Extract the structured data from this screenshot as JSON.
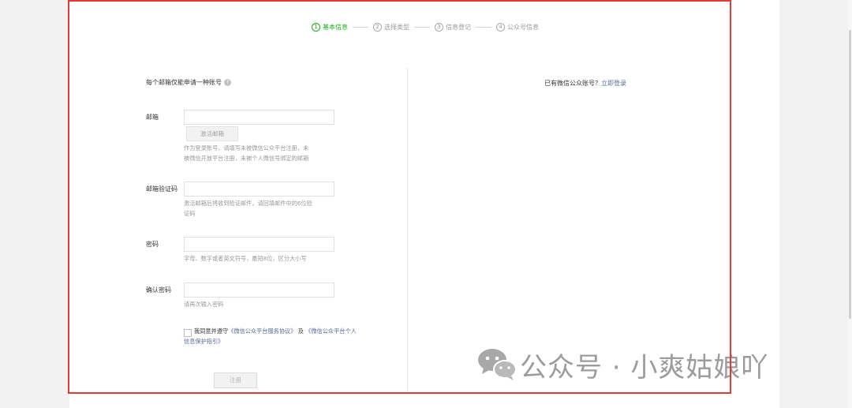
{
  "steps": [
    {
      "num": "1",
      "label": "基本信息",
      "active": true
    },
    {
      "num": "2",
      "label": "选择类型",
      "active": false
    },
    {
      "num": "3",
      "label": "信息登记",
      "active": false
    },
    {
      "num": "4",
      "label": "公众号信息",
      "active": false
    }
  ],
  "form": {
    "tip": "每个邮箱仅能申请一种账号",
    "help_icon_text": "?",
    "email": {
      "label": "邮箱",
      "value": "",
      "activate_label": "激活邮箱",
      "hint_line1": "作为登录账号，请填写未被微信公众平台注册，未",
      "hint_line2": "被微信开放平台注册，未被个人微信号绑定的邮箱"
    },
    "code": {
      "label": "邮箱验证码",
      "value": "",
      "hint_line1": "激活邮箱后将收到验证邮件，请回填邮件中的6位验",
      "hint_line2": "证码"
    },
    "password": {
      "label": "密码",
      "value": "",
      "hint": "字母、数字或者英文符号，最短8位，区分大小写"
    },
    "confirm": {
      "label": "确认密码",
      "value": "",
      "hint": "请再次输入密码"
    },
    "agree": {
      "prefix": "我同意并遵守",
      "link1": "《微信公众平台服务协议》",
      "mid": " 及 ",
      "link2_part1": "《微信公众平台个人",
      "link2_part2": "信息保护指引》"
    },
    "submit_label": "注册"
  },
  "right": {
    "prompt": "已有微信公众账号？",
    "login_link": "立即登录"
  },
  "watermark": {
    "icon": "wechat-icon",
    "text": "公众号 · 小爽姑娘吖"
  },
  "colors": {
    "accent_green": "#1aad19",
    "link_blue": "#576b95",
    "highlight_red": "#e53935"
  }
}
